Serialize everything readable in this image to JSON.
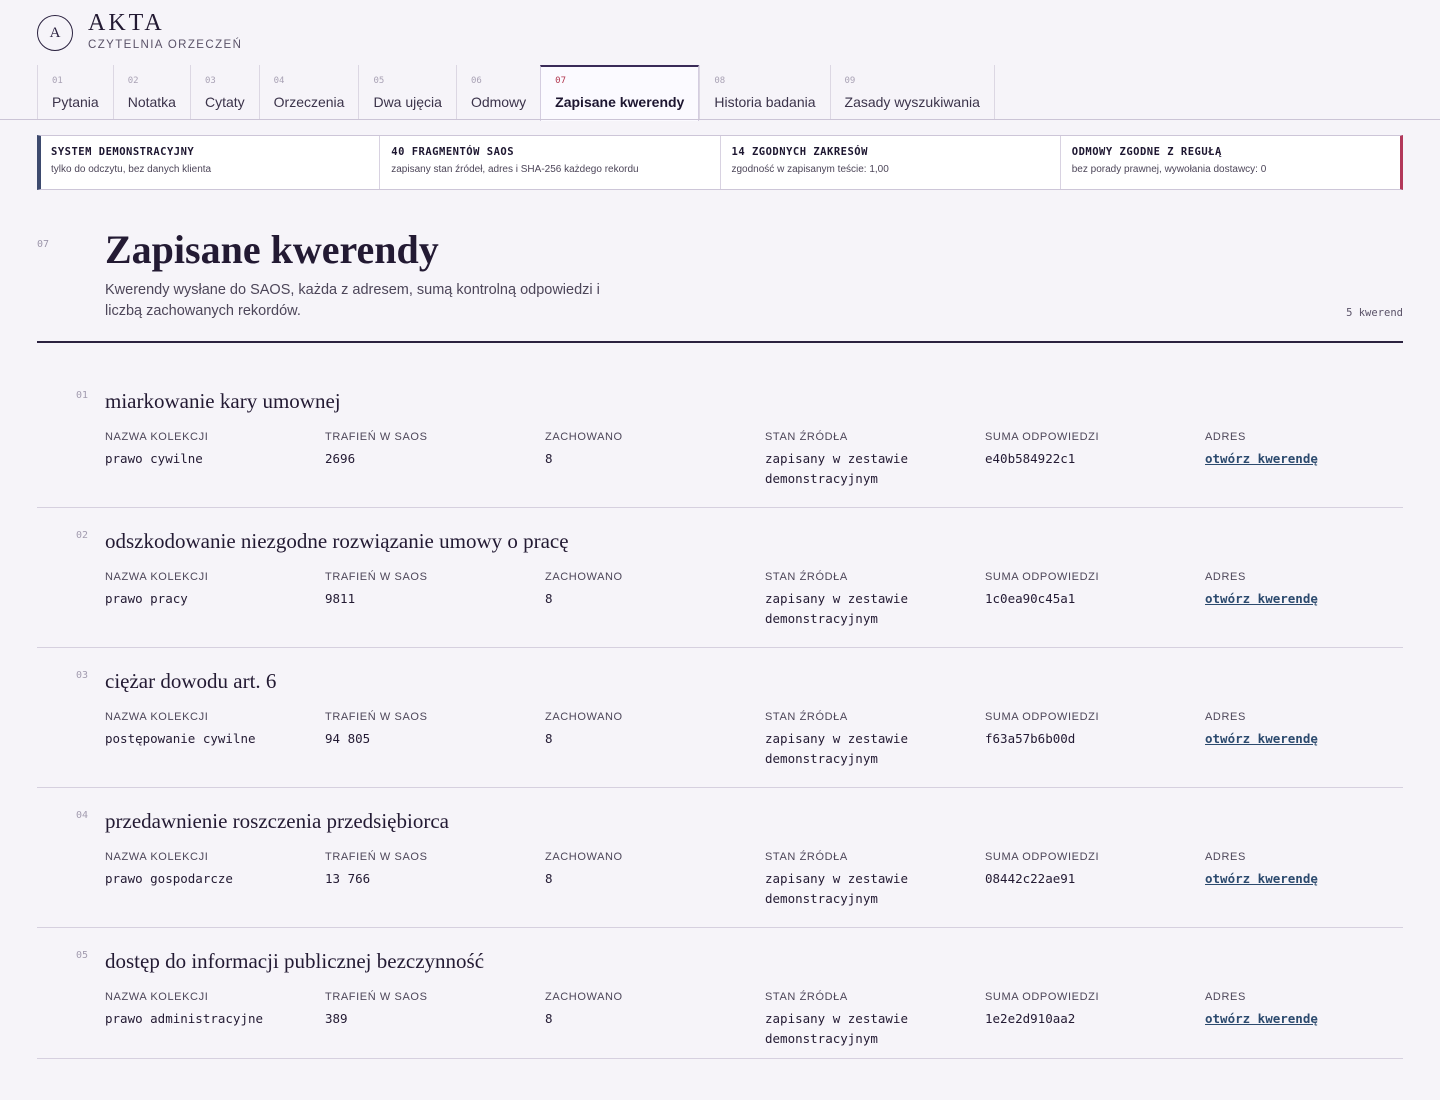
{
  "brand": {
    "logo_letter": "A",
    "name": "AKTA",
    "subtitle": "CZYTELNIA ORZECZEŃ"
  },
  "tabs": [
    {
      "num": "01",
      "label": "Pytania",
      "active": false
    },
    {
      "num": "02",
      "label": "Notatka",
      "active": false
    },
    {
      "num": "03",
      "label": "Cytaty",
      "active": false
    },
    {
      "num": "04",
      "label": "Orzeczenia",
      "active": false
    },
    {
      "num": "05",
      "label": "Dwa ujęcia",
      "active": false
    },
    {
      "num": "06",
      "label": "Odmowy",
      "active": false
    },
    {
      "num": "07",
      "label": "Zapisane kwerendy",
      "active": true
    },
    {
      "num": "08",
      "label": "Historia badania",
      "active": false
    },
    {
      "num": "09",
      "label": "Zasady wyszukiwania",
      "active": false
    }
  ],
  "status": [
    {
      "title": "SYSTEM DEMONSTRACYJNY",
      "desc": "tylko do odczytu, bez danych klienta"
    },
    {
      "title": "40 FRAGMENTÓW SAOS",
      "desc": "zapisany stan źródeł, adres i SHA-256 każdego rekordu"
    },
    {
      "title": "14 ZGODNYCH ZAKRESÓW",
      "desc": "zgodność w zapisanym teście: 1,00"
    },
    {
      "title": "ODMOWY ZGODNE Z REGUŁĄ",
      "desc": "bez porady prawnej, wywołania dostawcy: 0"
    }
  ],
  "page": {
    "section_num": "07",
    "title": "Zapisane kwerendy",
    "description": "Kwerendy wysłane do SAOS, każda z adresem, sumą kontrolną odpowiedzi i liczbą zachowanych rekordów.",
    "count": "5 kwerend"
  },
  "columns": {
    "collection": "NAZWA KOLEKCJI",
    "hits": "TRAFIEŃ W SAOS",
    "kept": "ZACHOWANO",
    "source_state": "STAN ŹRÓDŁA",
    "checksum": "SUMA ODPOWIEDZI",
    "address": "ADRES"
  },
  "queries": [
    {
      "num": "01",
      "title": "miarkowanie kary umownej",
      "collection": "prawo cywilne",
      "hits": "2696",
      "kept": "8",
      "source_state": "zapisany w zestawie demonstracyjnym",
      "checksum": "e40b584922c1",
      "link": "otwórz kwerendę"
    },
    {
      "num": "02",
      "title": "odszkodowanie niezgodne rozwiązanie umowy o pracę",
      "collection": "prawo pracy",
      "hits": "9811",
      "kept": "8",
      "source_state": "zapisany w zestawie demonstracyjnym",
      "checksum": "1c0ea90c45a1",
      "link": "otwórz kwerendę"
    },
    {
      "num": "03",
      "title": "ciężar dowodu art. 6",
      "collection": "postępowanie cywilne",
      "hits": "94 805",
      "kept": "8",
      "source_state": "zapisany w zestawie demonstracyjnym",
      "checksum": "f63a57b6b00d",
      "link": "otwórz kwerendę"
    },
    {
      "num": "04",
      "title": "przedawnienie roszczenia przedsiębiorca",
      "collection": "prawo gospodarcze",
      "hits": "13 766",
      "kept": "8",
      "source_state": "zapisany w zestawie demonstracyjnym",
      "checksum": "08442c22ae91",
      "link": "otwórz kwerendę"
    },
    {
      "num": "05",
      "title": "dostęp do informacji publicznej bezczynność",
      "collection": "prawo administracyjne",
      "hits": "389",
      "kept": "8",
      "source_state": "zapisany w zestawie demonstracyjnym",
      "checksum": "1e2e2d910aa2",
      "link": "otwórz kwerendę"
    }
  ]
}
